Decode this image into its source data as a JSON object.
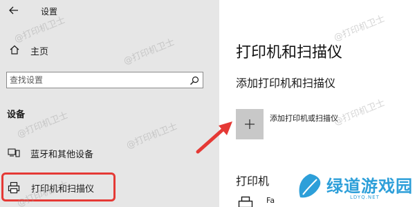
{
  "app": {
    "title": "设置"
  },
  "sidebar": {
    "home_label": "主页",
    "search_placeholder": "查找设置",
    "section_heading": "设备",
    "items": [
      {
        "label": "蓝牙和其他设备"
      },
      {
        "label": "打印机和扫描仪"
      }
    ]
  },
  "main": {
    "title": "打印机和扫描仪",
    "add_heading": "添加打印机和扫描仪",
    "add_button_label": "添加打印机或扫描仪",
    "printers_heading": "打印机",
    "printers": [
      {
        "name": "Fa"
      }
    ]
  },
  "overlay": {
    "watermark": "@打印机卫士",
    "logo_text": "绿道游戏园",
    "logo_domain": "LDYQ.NET"
  },
  "colors": {
    "sidebar_bg": "#e6e6e6",
    "highlight_border": "#e53935",
    "plus_tile": "#c8c8c8",
    "logo": "#2d9fd9"
  }
}
